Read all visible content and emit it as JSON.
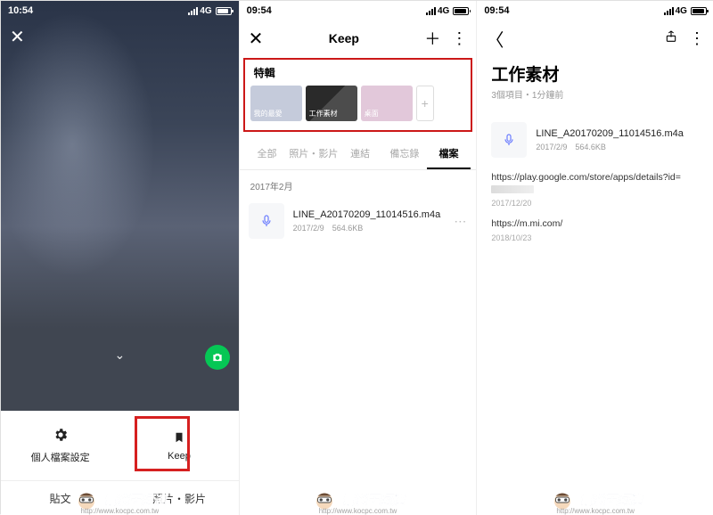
{
  "watermark": {
    "brand": "電腦王阿達",
    "url": "http://www.kocpc.com.tw"
  },
  "screen1": {
    "time": "10:54",
    "network": "4G",
    "tabs": {
      "profile_settings": "個人檔案設定",
      "keep": "Keep"
    },
    "bottom_tabs": {
      "posts": "貼文",
      "photos_videos": "照片・影片"
    }
  },
  "screen2": {
    "time": "09:54",
    "network": "4G",
    "title": "Keep",
    "collections_label": "特輯",
    "collections": [
      {
        "label": "我的最愛"
      },
      {
        "label": "工作素材"
      },
      {
        "label": "桌面"
      }
    ],
    "tabs": {
      "all": "全部",
      "photos": "照片・影片",
      "links": "連結",
      "memos": "備忘錄",
      "files": "檔案"
    },
    "section": "2017年2月",
    "file": {
      "name": "LINE_A20170209_11014516.m4a",
      "date": "2017/2/9",
      "size": "564.6KB"
    }
  },
  "screen3": {
    "time": "09:54",
    "network": "4G",
    "title": "工作素材",
    "subtitle": "3個項目・1分鐘前",
    "items": [
      {
        "type": "audio",
        "name": "LINE_A20170209_11014516.m4a",
        "date": "2017/2/9",
        "size": "564.6KB"
      },
      {
        "type": "link",
        "url_prefix": "https://play.google.com/store/apps/details?id=",
        "date": "2017/12/20"
      },
      {
        "type": "link",
        "url": "https://m.mi.com/",
        "date": "2018/10/23"
      }
    ]
  }
}
